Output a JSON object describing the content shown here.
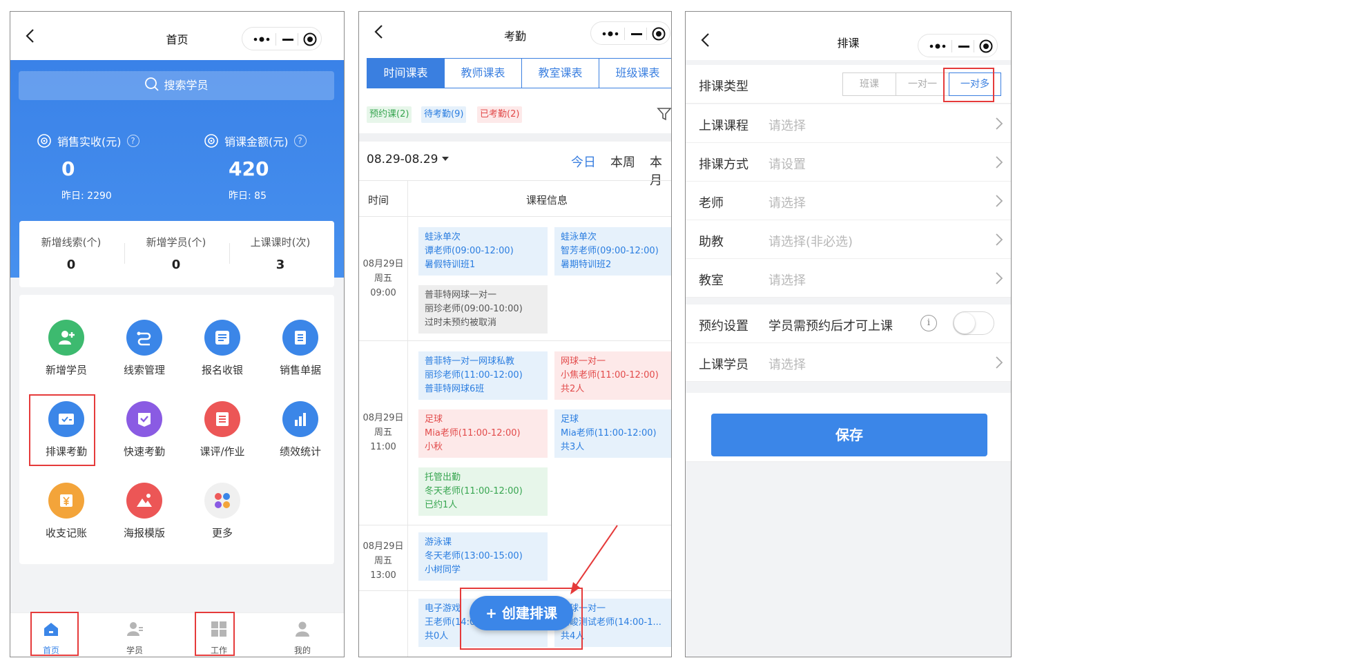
{
  "home": {
    "title": "首页",
    "search_placeholder": "搜索学员",
    "stats": [
      {
        "label": "销售实收(元)",
        "value": "0",
        "yesterday": "昨日: 2290"
      },
      {
        "label": "销课金额(元)",
        "value": "420",
        "yesterday": "昨日: 85"
      }
    ],
    "counts": [
      {
        "label": "新增线索(个)",
        "value": "0"
      },
      {
        "label": "新增学员(个)",
        "value": "0"
      },
      {
        "label": "上课课时(次)",
        "value": "3"
      }
    ],
    "grid": [
      {
        "label": "新增学员",
        "icon": "add-user-icon",
        "color": "#3dba6f"
      },
      {
        "label": "线索管理",
        "icon": "route-icon",
        "color": "#3b86e8"
      },
      {
        "label": "报名收银",
        "icon": "list-icon",
        "color": "#3b86e8"
      },
      {
        "label": "销售单据",
        "icon": "document-icon",
        "color": "#3b86e8"
      },
      {
        "label": "排课考勤",
        "icon": "schedule-icon",
        "color": "#3b86e8"
      },
      {
        "label": "快速考勤",
        "icon": "check-icon",
        "color": "#8a5be3"
      },
      {
        "label": "课评/作业",
        "icon": "homework-icon",
        "color": "#ec5656"
      },
      {
        "label": "绩效统计",
        "icon": "bar-chart-icon",
        "color": "#3b86e8"
      },
      {
        "label": "收支记账",
        "icon": "yuan-icon",
        "color": "#f3a43a"
      },
      {
        "label": "海报模版",
        "icon": "poster-icon",
        "color": "#ec5656"
      },
      {
        "label": "更多",
        "icon": "more-icon",
        "color": "#eeeeee"
      }
    ],
    "tabbar": [
      {
        "label": "首页",
        "icon": "home-icon"
      },
      {
        "label": "学员",
        "icon": "student-icon"
      },
      {
        "label": "工作",
        "icon": "work-icon"
      },
      {
        "label": "我的",
        "icon": "profile-icon"
      }
    ]
  },
  "attendance": {
    "title": "考勤",
    "tabs": [
      "时间课表",
      "教师课表",
      "教室课表",
      "班级课表"
    ],
    "filters": [
      "预约课(2)",
      "待考勤(9)",
      "已考勤(2)"
    ],
    "date_range": "08.29-08.29",
    "quick_ranges": [
      "今日",
      "本周",
      "本月"
    ],
    "col_time": "时间",
    "col_info": "课程信息",
    "slots": [
      {
        "date": "08月29日",
        "weekday": "周五",
        "time": "09:00"
      },
      {
        "date": "08月29日",
        "weekday": "周五",
        "time": "11:00"
      },
      {
        "date": "08月29日",
        "weekday": "周五",
        "time": "13:00"
      }
    ],
    "lessons": [
      {
        "l1": "蛙泳单次",
        "l2": "谭老师(09:00-12:00)",
        "l3": "暑假特训班1"
      },
      {
        "l1": "蛙泳单次",
        "l2": "智芳老师(09:00-12:00)",
        "l3": "暑期特训班2"
      },
      {
        "l1": "普菲特网球一对一",
        "l2": "丽珍老师(09:00-10:00)",
        "l3": "过时未预约被取消"
      },
      {
        "l1": "普菲特一对一网球私教",
        "l2": "丽珍老师(11:00-12:00)",
        "l3": "普菲特网球6班"
      },
      {
        "l1": "网球一对一",
        "l2": "小焦老师(11:00-12:00)",
        "l3": "共2人"
      },
      {
        "l1": "足球",
        "l2": "Mia老师(11:00-12:00)",
        "l3": "小秋"
      },
      {
        "l1": "足球",
        "l2": "Mia老师(11:00-12:00)",
        "l3": "共3人"
      },
      {
        "l1": "托管出勤",
        "l2": "冬天老师(11:00-12:00)",
        "l3": "已约1人"
      },
      {
        "l1": "游泳课",
        "l2": "冬天老师(13:00-15:00)",
        "l3": "小树同学"
      },
      {
        "l1": "电子游戏",
        "l2": "王老师(14:00-...",
        "l3": "共0人"
      },
      {
        "l1": "网球一对一",
        "l2": "谢峻测试老师(14:00-1...",
        "l3": "共4人"
      }
    ],
    "fab_label": "+ 创建排课"
  },
  "schedule": {
    "title": "排课",
    "type_label": "排课类型",
    "type_options": [
      "班课",
      "一对一",
      "一对多"
    ],
    "type_selected": "一对多",
    "rows": [
      {
        "label": "上课课程",
        "value": "请选择"
      },
      {
        "label": "排课方式",
        "value": "请设置"
      },
      {
        "label": "老师",
        "value": "请选择"
      },
      {
        "label": "助教",
        "value": "请选择(非必选)"
      },
      {
        "label": "教室",
        "value": "请选择"
      }
    ],
    "booking_label": "预约设置",
    "booking_text": "学员需预约后才可上课",
    "booking_info_glyph": "i",
    "booking_enabled": false,
    "students_label": "上课学员",
    "students_value": "请选择",
    "save_label": "保存"
  },
  "colors": {
    "primary": "#3b86e8",
    "highlight": "#e53a3a"
  }
}
